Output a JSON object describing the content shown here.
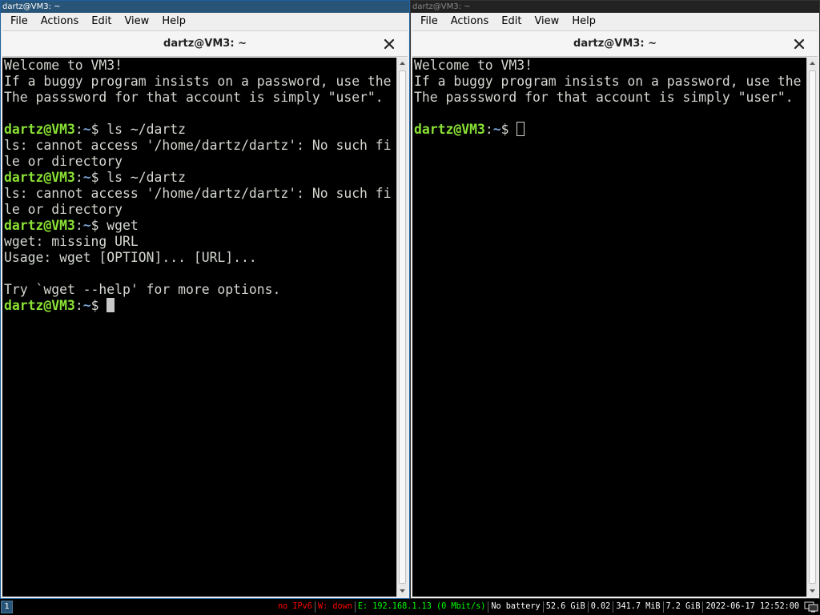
{
  "left_window": {
    "title": "dartz@VM3: ~",
    "menu": [
      "File",
      "Actions",
      "Edit",
      "View",
      "Help"
    ],
    "tab_title": "dartz@VM3: ~",
    "lines": [
      {
        "text": "Welcome to VM3!"
      },
      {
        "text": "If a buggy program insists on a password, use the"
      },
      {
        "text": "The passsword for that account is simply \"user\"."
      },
      {
        "text": ""
      },
      {
        "user": "dartz@VM3",
        "sep": ":",
        "path": "~",
        "cmd": "$ ls ~/dartz"
      },
      {
        "text": "ls: cannot access '/home/dartz/dartz': No such fi"
      },
      {
        "text": "le or directory"
      },
      {
        "user": "dartz@VM3",
        "sep": ":",
        "path": "~",
        "cmd": "$ ls ~/dartz"
      },
      {
        "text": "ls: cannot access '/home/dartz/dartz': No such fi"
      },
      {
        "text": "le or directory"
      },
      {
        "user": "dartz@VM3",
        "sep": ":",
        "path": "~",
        "cmd": "$ wget"
      },
      {
        "text": "wget: missing URL"
      },
      {
        "text": "Usage: wget [OPTION]... [URL]..."
      },
      {
        "text": ""
      },
      {
        "text": "Try `wget --help' for more options."
      },
      {
        "user": "dartz@VM3",
        "sep": ":",
        "path": "~",
        "cmd": "$ ",
        "cursor": "block"
      }
    ]
  },
  "right_window": {
    "title": "dartz@VM3: ~",
    "menu": [
      "File",
      "Actions",
      "Edit",
      "View",
      "Help"
    ],
    "tab_title": "dartz@VM3: ~",
    "lines": [
      {
        "text": "Welcome to VM3!"
      },
      {
        "text": "If a buggy program insists on a password, use the"
      },
      {
        "text": "The passsword for that account is simply \"user\"."
      },
      {
        "text": ""
      },
      {
        "user": "dartz@VM3",
        "sep": ":",
        "path": "~",
        "cmd": "$ ",
        "cursor": "hollow"
      }
    ]
  },
  "statusbar": {
    "workspace": "1",
    "items": [
      {
        "text": "no IPv6",
        "color": "#ff0000"
      },
      {
        "text": "W: down",
        "color": "#ff0000"
      },
      {
        "text": "E: 192.168.1.13 (0 Mbit/s)",
        "color": "#00ff00"
      },
      {
        "text": "No battery",
        "color": "#ffffff"
      },
      {
        "text": "52.6 GiB",
        "color": "#ffffff"
      },
      {
        "text": "0.02",
        "color": "#ffffff"
      },
      {
        "text": "341.7 MiB",
        "color": "#ffffff"
      },
      {
        "text": "7.2 GiB",
        "color": "#ffffff"
      },
      {
        "text": "2022-06-17 12:52:00",
        "color": "#ffffff"
      }
    ],
    "tray_icon": "network-tray-icon"
  },
  "colors": {
    "focused_title_bg": "#285577",
    "prompt_user": "#8ae234",
    "prompt_path": "#729fcf",
    "terminal_fg": "#d3d7cf"
  }
}
